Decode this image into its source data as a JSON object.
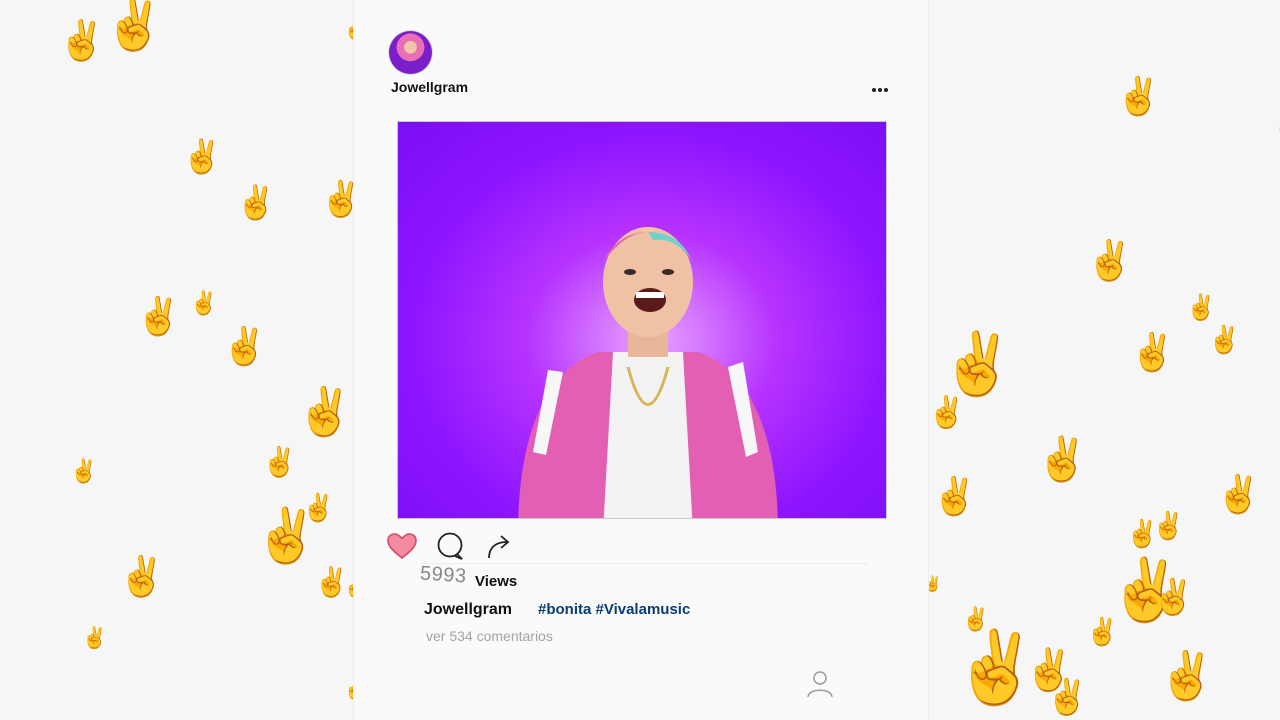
{
  "post": {
    "username": "Jowellgram",
    "more_icon": "more-dots-icon",
    "views_count": "5993",
    "views_label": "Views",
    "caption_username": "Jowellgram",
    "caption_tags": "#bonita #Vivalamusic",
    "comments_link": "ver 534 comentarios"
  },
  "actions": {
    "like_icon": "heart-icon",
    "comment_icon": "comment-bubble-icon",
    "share_icon": "share-arrow-icon"
  },
  "background": {
    "emoji": "✌",
    "emoji_name": "victory-hand-emoji"
  },
  "colors": {
    "background": "#f7f6f6",
    "card": "#fafafa",
    "media_purple": "#9b1cff",
    "heart_fill": "#f48ba0",
    "hashtag": "#0b3d73",
    "muted_text": "#a3a3a3"
  }
}
